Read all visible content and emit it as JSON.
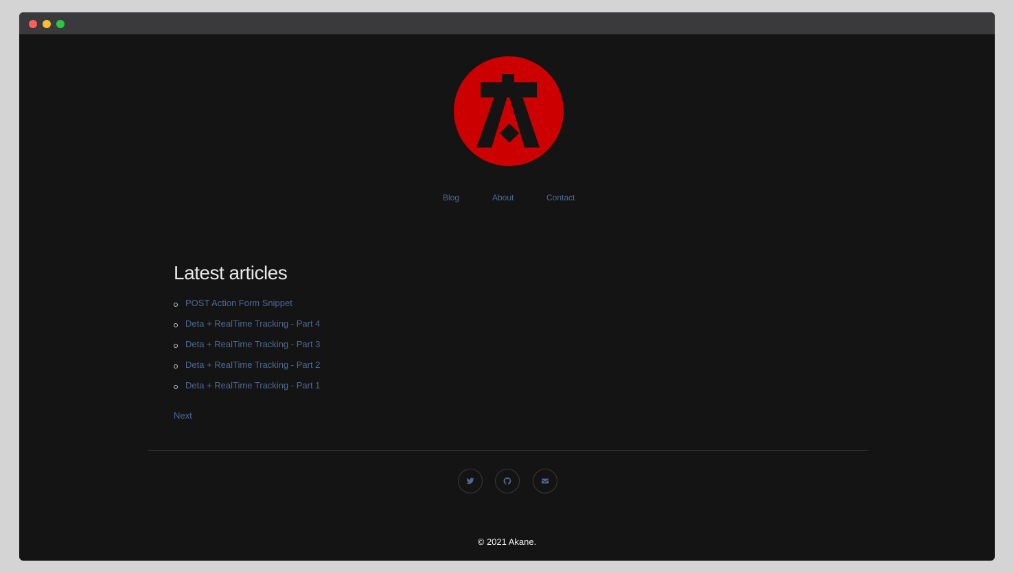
{
  "colors": {
    "background": "#141415",
    "link": "#4c6a94",
    "logo_red": "#cc0000"
  },
  "nav": {
    "items": [
      {
        "label": "Blog"
      },
      {
        "label": "About"
      },
      {
        "label": "Contact"
      }
    ]
  },
  "main": {
    "heading": "Latest articles",
    "articles": [
      {
        "title": "POST Action Form Snippet"
      },
      {
        "title": "Deta + RealTime Tracking - Part 4"
      },
      {
        "title": "Deta + RealTime Tracking - Part 3"
      },
      {
        "title": "Deta + RealTime Tracking - Part 2"
      },
      {
        "title": "Deta + RealTime Tracking - Part 1"
      }
    ],
    "next_label": "Next"
  },
  "footer": {
    "social": [
      {
        "icon": "twitter-icon"
      },
      {
        "icon": "github-icon"
      },
      {
        "icon": "email-icon"
      }
    ],
    "copyright": "© 2021 Akane."
  }
}
